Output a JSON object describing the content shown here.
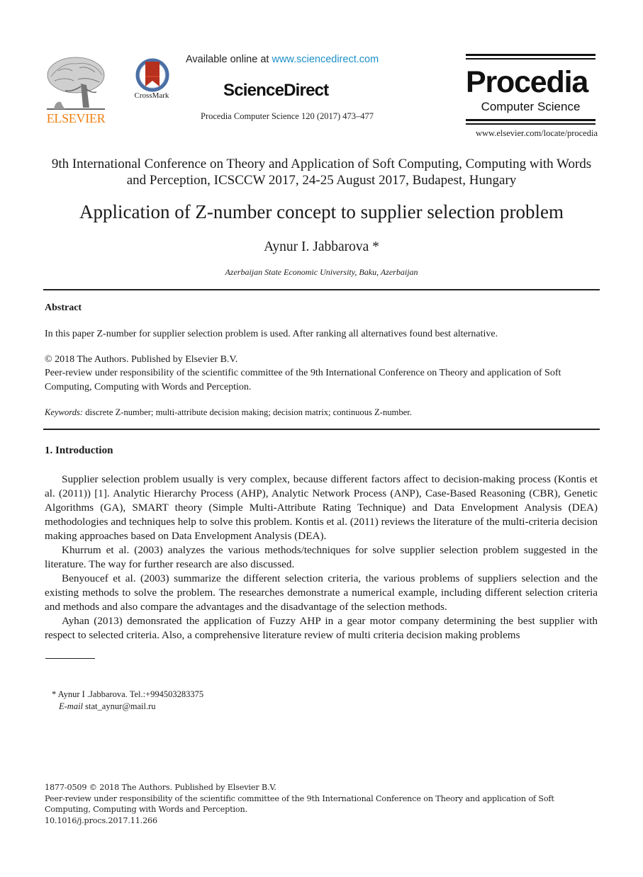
{
  "header": {
    "publisher_name": "ELSEVIER",
    "crossmark_label": "CrossMark",
    "available_prefix": "Available online at ",
    "available_link": "www.sciencedirect.com",
    "sciencedirect_logo": "ScienceDirect",
    "journal_reference": "Procedia Computer Science 120 (2017) 473–477",
    "procedia_title": "Procedia",
    "procedia_subtitle": "Computer Science",
    "procedia_url": "www.elsevier.com/locate/procedia",
    "colors": {
      "elsevier_orange": "#f07f12",
      "link_blue": "#1e90c8",
      "crossmark_red": "#b7301e",
      "crossmark_ring": "#4a6fa5"
    }
  },
  "paper": {
    "conference": "9th International Conference on Theory and Application of Soft Computing, Computing with Words and Perception, ICSCCW 2017, 24-25 August 2017, Budapest, Hungary",
    "title": "Application of Z-number concept to supplier selection problem",
    "author": "Aynur I. Jabbarova *",
    "affiliation": "Azerbaijan State Economic University, Baku, Azerbaijan"
  },
  "abstract": {
    "heading": "Abstract",
    "text": "In this paper Z-number for supplier selection problem is used. After ranking all alternatives found best alternative.",
    "copyright": "© 2018 The Authors. Published by Elsevier B.V.",
    "peer_review": "Peer-review under responsibility of the scientific committee of the 9th International Conference on Theory and application of Soft Computing, Computing with Words and Perception.",
    "keywords_label": "Keywords:",
    "keywords": " discrete Z-number; multi-attribute decision making; decision matrix; continuous Z-number."
  },
  "introduction": {
    "heading": "1. Introduction",
    "paragraphs": [
      "Supplier selection problem usually is very complex, because different factors affect to decision-making process (Kontis et al. (2011)) [1]. Analytic Hierarchy Process (AHP), Analytic Network Process (ANP), Case-Based Reasoning (CBR), Genetic Algorithms (GA), SMART theory (Simple Multi-Attribute Rating Technique) and Data Envelopment Analysis (DEA) methodologies and techniques help to solve this problem. Kontis et al. (2011) reviews the literature of the multi-criteria decision making approaches based on Data Envelopment Analysis (DEA).",
      "Khurrum et al. (2003) analyzes the various methods/techniques for solve supplier selection problem suggested in the literature. The way for further research are also discussed.",
      "Benyoucef et al. (2003) summarize the different selection criteria, the various problems of suppliers selection and the existing methods to solve the problem. The researches demonstrate a numerical example, including different selection criteria and methods and also compare the advantages and the disadvantage of the selection methods.",
      "Ayhan (2013) demonsrated the application of Fuzzy AHP in a gear motor company determining the best supplier with respect to selected criteria. Also, a comprehensive literature review of multi criteria decision making problems"
    ]
  },
  "footnote": {
    "line1": "* Aynur I .Jabbarova. Tel.:+994503283375",
    "email_label": "E-mail",
    "email": " stat_aynur@mail.ru"
  },
  "bottom_matter": {
    "issn_line": "1877-0509 © 2018 The Authors. Published by Elsevier B.V.",
    "peer_review": "Peer-review under responsibility of the scientific committee of the 9th International Conference on Theory and application of Soft Computing, Computing with Words and Perception.",
    "doi": "10.1016/j.procs.2017.11.266"
  }
}
